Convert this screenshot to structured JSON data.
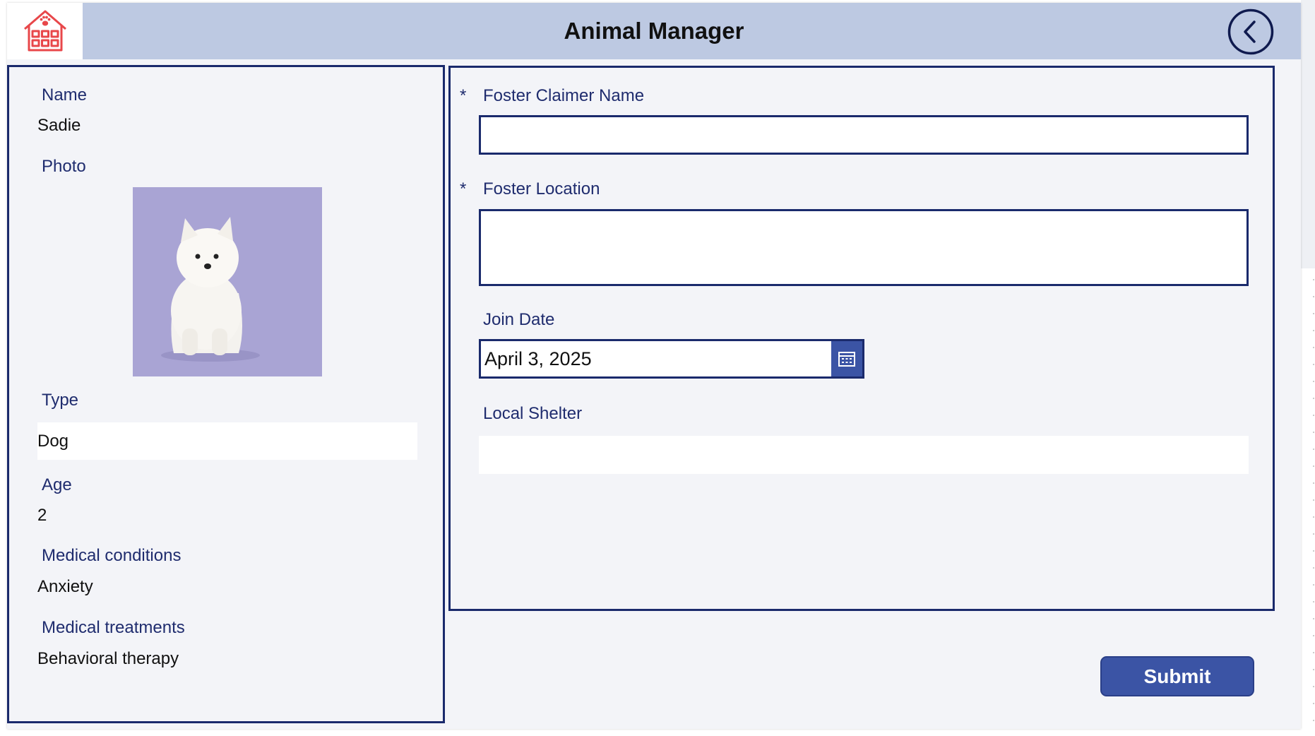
{
  "header": {
    "title": "Animal Manager",
    "logo_icon": "shelter-house-paw-icon",
    "back_icon": "chevron-left-circle-icon"
  },
  "animal": {
    "name_label": "Name",
    "name_value": "Sadie",
    "photo_label": "Photo",
    "photo_icon": "white-puppy-photo",
    "type_label": "Type",
    "type_value": "Dog",
    "age_label": "Age",
    "age_value": "2",
    "conditions_label": "Medical conditions",
    "conditions_value": "Anxiety",
    "treatments_label": "Medical treatments",
    "treatments_value": "Behavioral therapy"
  },
  "form": {
    "required_marker": "*",
    "claimer_label": "Foster Claimer Name",
    "claimer_value": "",
    "location_label": "Foster Location",
    "location_value": "",
    "join_date_label": "Join Date",
    "join_date_value": "April 3, 2025",
    "calendar_icon": "calendar-icon",
    "shelter_label": "Local Shelter",
    "shelter_value": ""
  },
  "actions": {
    "submit_label": "Submit"
  },
  "colors": {
    "header_bg": "#bdc9e2",
    "accent": "#3b54a5",
    "border": "#1a2a6c",
    "logo_red": "#e8474a"
  }
}
